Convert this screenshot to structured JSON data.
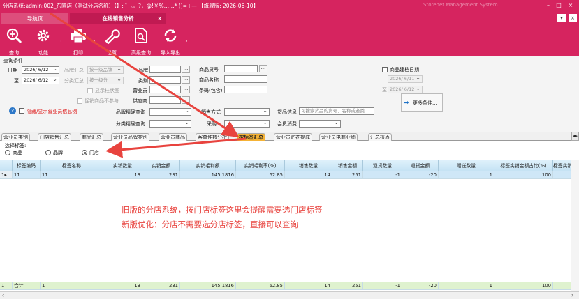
{
  "window": {
    "title": "分店系统:admin:002_东圃店（测试分店名称）【】: ゛。。?，@!￥%……* ()=+— 【旗舰版: 2026-06-10】",
    "system_name": "Storenet Management System",
    "minimize": "–",
    "maximize": "□",
    "close": "×"
  },
  "tabs": [
    {
      "label": "导航页"
    },
    {
      "label": "在线销售分析",
      "close": "×"
    }
  ],
  "tabbar_buttons": {
    "dropdown": "▾",
    "close": "×"
  },
  "toolbar": {
    "query": "查询",
    "func": "功能",
    "print": "打印",
    "settings": "设置",
    "advanced_query": "高级查询",
    "import_export": "导入导出",
    "sep": "·"
  },
  "query": {
    "section_title": "查询条件",
    "date_label": "日期",
    "date_from": "2026/ 6/12",
    "to_label": "至",
    "date_to": "2026/ 6/12",
    "brand_summary_label": "品牌汇总",
    "brand_summary_value": "按一级品牌",
    "category_summary_label": "分类汇总",
    "category_summary_value": "按一级分",
    "show_chart_label": "显示柱状图",
    "promo_exclude_label": "促销商品不参与",
    "brand_label": "品牌",
    "category_label": "类别",
    "sales_staff_label": "营业员",
    "supplier_label": "供应商",
    "goods_no_label": "商品货号",
    "goods_name_label": "商品名称",
    "barcode_label": "条码(包含)",
    "brand_exact_label": "品牌精确查询",
    "category_exact_label": "分类精确查询",
    "sales_mode_label": "销售方式",
    "purchase_label": "采购",
    "goods_info_label": "货品信息",
    "goods_info_placeholder": "可搜索货品的货号、名称或者类",
    "member_label": "会员消费",
    "goods_build_date_label": "商品建档日期",
    "build_date_from": "2026/ 6/11",
    "build_to_label": "至",
    "build_date_to": "2026/ 6/12",
    "more_conditions": "更多条件...",
    "help_icon": "?",
    "warn_text": "隐藏/显示营业员信息例",
    "dots": "..."
  },
  "subtabs": [
    "营业员类别",
    "门店销售汇总",
    "商品汇总",
    "营业员品牌类别",
    "营业员商品",
    "客单件数分析",
    "按标签汇总",
    "营业员贴花提成",
    "营业员电商业绩",
    "汇总报表"
  ],
  "subtabs_scroll": "◂▸",
  "tag_select": {
    "label": "选择标签:",
    "options": [
      "商品",
      "品牌",
      "门店"
    ],
    "selected": "门店"
  },
  "grid": {
    "columns": [
      "标签编码",
      "标签名称",
      "实销数量",
      "实销金额",
      "实销毛利额",
      "实销毛利率(%)",
      "销售数量",
      "销售金额",
      "退货数量",
      "退货金额",
      "赠送数量",
      "标签实销金额占比(%)",
      "标签实销"
    ],
    "rows": [
      {
        "row_no": "1",
        "marker": "▸",
        "cells": [
          "11",
          "11",
          "13",
          "231",
          "145.1816",
          "62.85",
          "14",
          "251",
          "-1",
          "-20",
          "1",
          "100",
          ""
        ]
      }
    ],
    "summary": {
      "row_no": "1",
      "cells": [
        "合计",
        "1",
        "13",
        "231",
        "145.1816",
        "62.85",
        "14",
        "251",
        "-1",
        "-20",
        "1",
        "100",
        ""
      ]
    }
  },
  "annotation": {
    "line1": "旧版的分店系统，按门店标签这里会提醒需要选门店标签",
    "line2": "新版优化：分店不需要选分店标签，直接可以查询"
  },
  "scroll": {
    "left": "‹",
    "right": "›",
    "collapse": "◂"
  },
  "colors": {
    "brand": "#d6245f",
    "active_tab": "#f5b336",
    "note": "#e8433e"
  }
}
